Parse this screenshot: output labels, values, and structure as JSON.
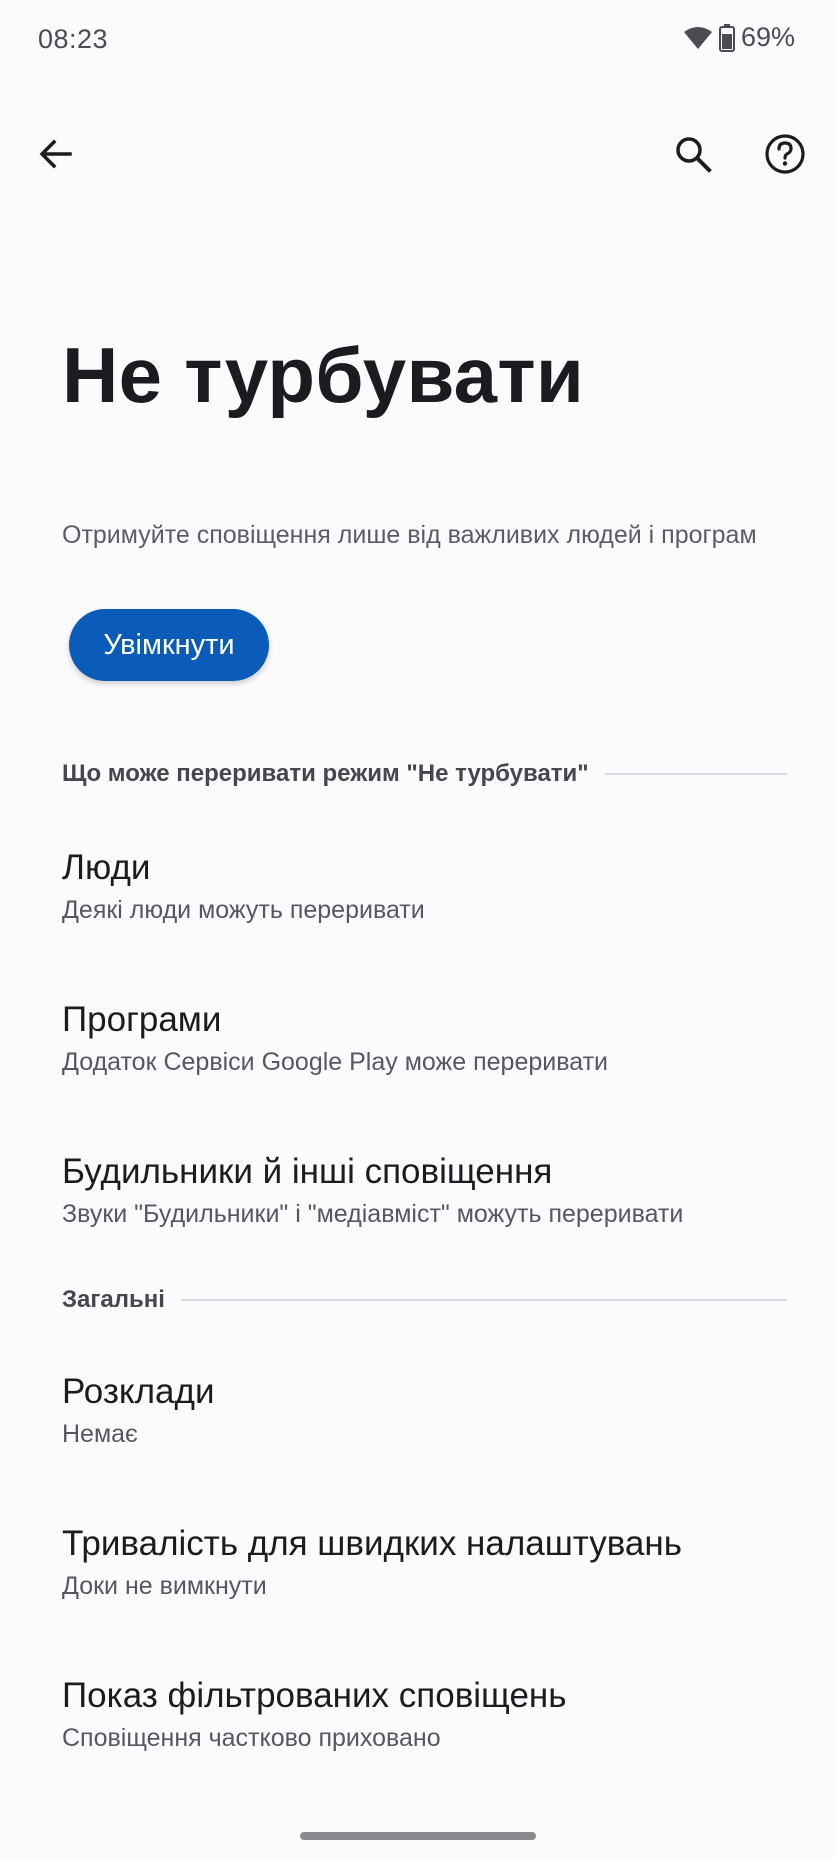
{
  "status_bar": {
    "time": "08:23",
    "battery_percent": "69%",
    "wifi_icon": "wifi-icon",
    "battery_icon": "battery-icon"
  },
  "top_bar": {
    "back_icon": "arrow-back-icon",
    "search_icon": "search-icon",
    "help_icon": "help-circle-icon"
  },
  "page": {
    "title": "Не турбувати",
    "subtitle": "Отримуйте сповіщення лише від важливих людей і програм",
    "turn_on_label": "Увімкнути"
  },
  "sections": [
    {
      "header": "Що може переривати режим \"Не турбувати\"",
      "items": [
        {
          "title": "Люди",
          "summary": "Деякі люди можуть переривати"
        },
        {
          "title": "Програми",
          "summary": "Додаток Сервіси Google Play може переривати"
        },
        {
          "title": "Будильники й інші сповіщення",
          "summary": "Звуки \"Будильники\" і \"медіавміст\" можуть переривати"
        }
      ]
    },
    {
      "header": "Загальні",
      "items": [
        {
          "title": "Розклади",
          "summary": "Немає"
        },
        {
          "title": "Тривалість для швидких налаштувань",
          "summary": "Доки не вимкнути"
        },
        {
          "title": "Показ фільтрованих сповіщень",
          "summary": "Сповіщення частково приховано"
        }
      ]
    }
  ],
  "colors": {
    "accent": "#0b5cb8",
    "background": "#fbfbfd",
    "text_primary": "#1b1c1f",
    "text_secondary": "#55585e"
  }
}
